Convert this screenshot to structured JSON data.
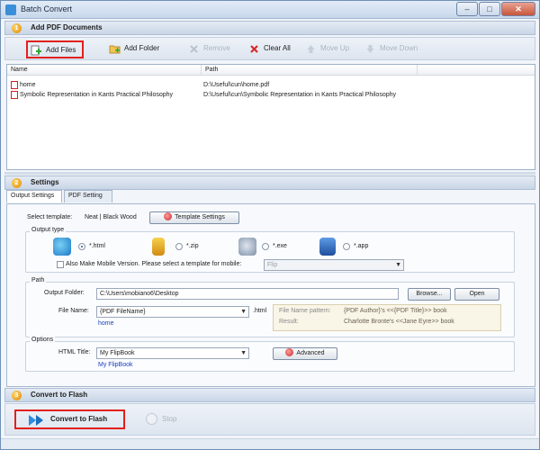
{
  "window": {
    "title": "Batch Convert",
    "minimize": "–",
    "maximize": "□",
    "close": "✕"
  },
  "section1": {
    "num": "1",
    "title": "Add PDF Documents"
  },
  "toolbar": {
    "add_files": "Add Files",
    "add_folder": "Add Folder",
    "remove": "Remove",
    "clear_all": "Clear All",
    "move_up": "Move Up",
    "move_down": "Move Down"
  },
  "filelist": {
    "col_name": "Name",
    "col_path": "Path",
    "rows": [
      {
        "name": "home",
        "path": "D:\\Useful\\cun\\home.pdf"
      },
      {
        "name": "Symbolic Representation in Kants Practical Philosophy",
        "path": "D:\\Useful\\cun\\Symbolic Representation in Kants Practical Philosophy"
      }
    ]
  },
  "section2": {
    "num": "2",
    "title": "Settings"
  },
  "tabs": {
    "output": "Output Settings",
    "pdf": "PDF Setting"
  },
  "template": {
    "label": "Select template:",
    "value": "Neat | Black Wood",
    "button": "Template Settings"
  },
  "output_type": {
    "title": "Output type",
    "options": [
      "*.html",
      "*.zip",
      "*.exe",
      "*.app"
    ],
    "selected": "*.html",
    "mobile_label": "Also Make Mobile Version. Please select a template for mobile:",
    "mobile_value": "Flip"
  },
  "path": {
    "title": "Path",
    "folder_label": "Output Folder:",
    "folder_value": "C:\\Users\\mobiano6\\Desktop",
    "browse": "Browse...",
    "open": "Open",
    "filename_label": "File Name:",
    "filename_value": "{PDF FileName}",
    "filename_ext": ".html",
    "filename_example": "home",
    "pattern_label": "File Name pattern:",
    "pattern_value": "{PDF Author}'s <<{PDF Title}>> book",
    "result_label": "Result:",
    "result_value": "Charlotte Bronte's <<Jane Eyre>> book"
  },
  "options": {
    "title": "Options",
    "html_title_label": "HTML Title:",
    "html_title_value": "My FlipBook",
    "html_title_example": "My FlipBook",
    "advanced": "Advanced"
  },
  "section3": {
    "num": "3",
    "title": "Convert to Flash"
  },
  "bottom": {
    "convert": "Convert to Flash",
    "stop": "Stop"
  },
  "colors": {
    "highlight": "#e3201b",
    "accent": "#3b8fd8"
  }
}
